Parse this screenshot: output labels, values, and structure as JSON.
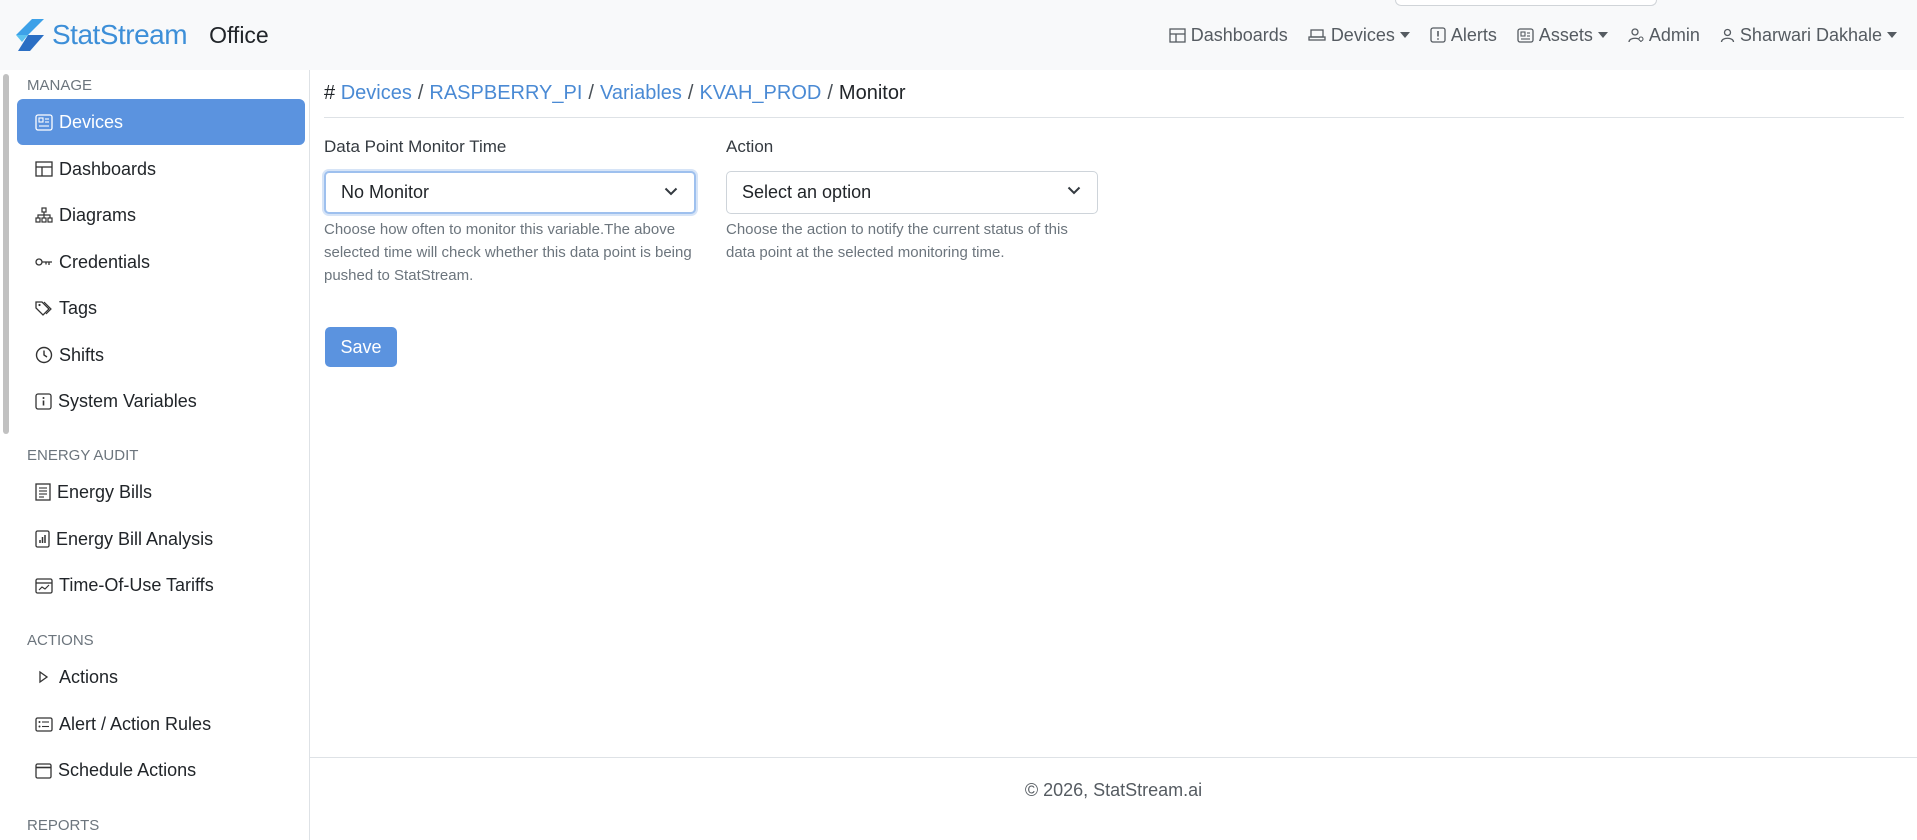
{
  "brand": {
    "name": "StatStream",
    "workspace": "Office",
    "logo_color": "#3d8fd8"
  },
  "topnav": {
    "dashboards": "Dashboards",
    "devices": "Devices",
    "alerts": "Alerts",
    "assets": "Assets",
    "admin": "Admin",
    "user": "Sharwari Dakhale"
  },
  "sidebar": {
    "manage_label": "MANAGE",
    "manage_items": [
      "Devices",
      "Dashboards",
      "Diagrams",
      "Credentials",
      "Tags",
      "Shifts",
      "System Variables"
    ],
    "energy_label": "ENERGY AUDIT",
    "energy_items": [
      "Energy Bills",
      "Energy Bill Analysis",
      "Time-Of-Use Tariffs"
    ],
    "actions_label": "ACTIONS",
    "actions_items": [
      "Actions",
      "Alert / Action Rules",
      "Schedule Actions"
    ],
    "reports_label": "REPORTS",
    "active_item": "Devices",
    "active_color": "#5b93df"
  },
  "breadcrumb": {
    "hash": "#",
    "items": [
      "Devices",
      "RASPBERRY_PI",
      "Variables",
      "KVAH_PROD"
    ],
    "current": "Monitor",
    "separator": "/"
  },
  "form": {
    "monitor_time": {
      "label": "Data Point Monitor Time",
      "value": "No Monitor",
      "help": "Choose how often to monitor this variable.The above selected time will check whether this data point is being pushed to StatStream."
    },
    "action": {
      "label": "Action",
      "value": "Select an option",
      "help": "Choose the action to notify the current status of this data point at the selected monitoring time."
    },
    "save_label": "Save"
  },
  "footer": {
    "text": "© 2026, StatStream.ai"
  }
}
